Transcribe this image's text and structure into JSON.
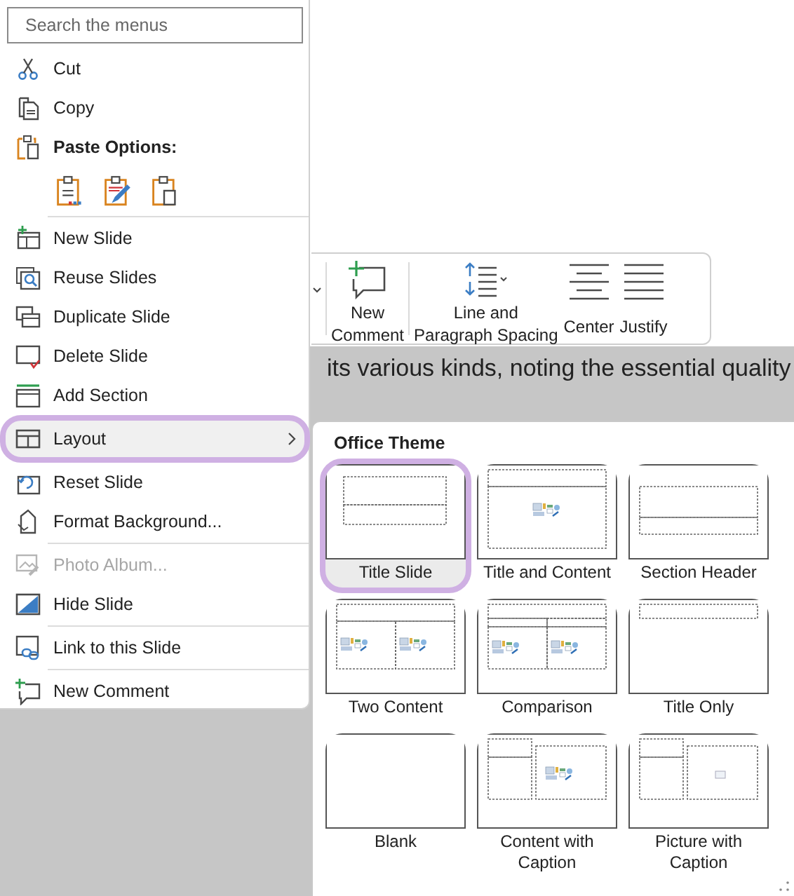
{
  "search": {
    "placeholder": "Search the menus"
  },
  "menu": [
    {
      "kind": "item",
      "label": "Cut",
      "disabled": false,
      "selected": false,
      "submenu": false,
      "divider_above": false
    },
    {
      "kind": "item",
      "label": "Copy",
      "disabled": false,
      "selected": false,
      "submenu": false,
      "divider_above": false
    },
    {
      "kind": "header",
      "label": "Paste Options:"
    },
    {
      "kind": "paste-row"
    },
    {
      "kind": "item",
      "label": "New Slide",
      "disabled": false,
      "selected": false,
      "submenu": false,
      "divider_above": true
    },
    {
      "kind": "item",
      "label": "Reuse Slides",
      "disabled": false,
      "selected": false,
      "submenu": false,
      "divider_above": false
    },
    {
      "kind": "item",
      "label": "Duplicate Slide",
      "disabled": false,
      "selected": false,
      "submenu": false,
      "divider_above": false
    },
    {
      "kind": "item",
      "label": "Delete Slide",
      "disabled": false,
      "selected": false,
      "submenu": false,
      "divider_above": false
    },
    {
      "kind": "item",
      "label": "Add Section",
      "disabled": false,
      "selected": false,
      "submenu": false,
      "divider_above": false
    },
    {
      "kind": "item",
      "label": "Layout",
      "disabled": false,
      "selected": true,
      "submenu": true,
      "divider_above": false
    },
    {
      "kind": "item",
      "label": "Reset Slide",
      "disabled": false,
      "selected": false,
      "submenu": false,
      "divider_above": false
    },
    {
      "kind": "item",
      "label": "Format Background...",
      "disabled": false,
      "selected": false,
      "submenu": false,
      "divider_above": false
    },
    {
      "kind": "item",
      "label": "Photo Album...",
      "disabled": true,
      "selected": false,
      "submenu": false,
      "divider_above": true
    },
    {
      "kind": "item",
      "label": "Hide Slide",
      "disabled": false,
      "selected": false,
      "submenu": false,
      "divider_above": false
    },
    {
      "kind": "item",
      "label": "Link to this Slide",
      "disabled": false,
      "selected": false,
      "submenu": false,
      "divider_above": true
    },
    {
      "kind": "item",
      "label": "New Comment",
      "disabled": false,
      "selected": false,
      "submenu": false,
      "divider_above": true
    }
  ],
  "toolbar": {
    "items": [
      {
        "label": "New\nComment",
        "divider_before": true
      },
      {
        "label": "Line and\nParagraph Spacing",
        "divider_before": true
      },
      {
        "label": "Center",
        "divider_before": false
      },
      {
        "label": "Justify",
        "divider_before": false
      }
    ]
  },
  "document": {
    "text": "its various kinds, noting the essential quality"
  },
  "gallery": {
    "title": "Office Theme",
    "tiles": [
      {
        "label": "Title Slide",
        "selected": true
      },
      {
        "label": "Title and Content",
        "selected": false
      },
      {
        "label": "Section Header",
        "selected": false
      },
      {
        "label": "Two Content",
        "selected": false
      },
      {
        "label": "Comparison",
        "selected": false
      },
      {
        "label": "Title Only",
        "selected": false
      },
      {
        "label": "Blank",
        "selected": false
      },
      {
        "label": "Content with\nCaption",
        "selected": false
      },
      {
        "label": "Picture with\nCaption",
        "selected": false
      }
    ]
  }
}
